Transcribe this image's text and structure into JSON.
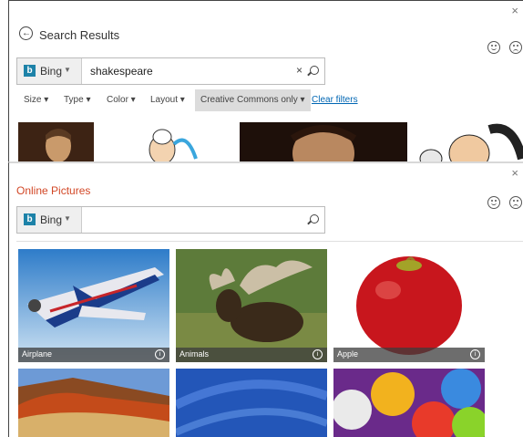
{
  "search_results": {
    "title": "Search Results",
    "search_engine": "Bing",
    "query": "shakespeare",
    "filters": [
      "Size",
      "Type",
      "Color",
      "Layout"
    ],
    "active_filter": "Creative Commons only",
    "clear_filters": "Clear filters",
    "logo_letter": "b"
  },
  "online_pictures": {
    "title": "Online Pictures",
    "search_engine": "Bing",
    "search_value": "",
    "logo_letter": "b",
    "categories": [
      {
        "label": "Airplane"
      },
      {
        "label": "Animals"
      },
      {
        "label": "Apple"
      },
      {
        "label": ""
      },
      {
        "label": ""
      },
      {
        "label": ""
      }
    ]
  },
  "colors": {
    "accent": "#d24726",
    "link": "#0066b3",
    "bing_blue": "#1d82a8"
  }
}
